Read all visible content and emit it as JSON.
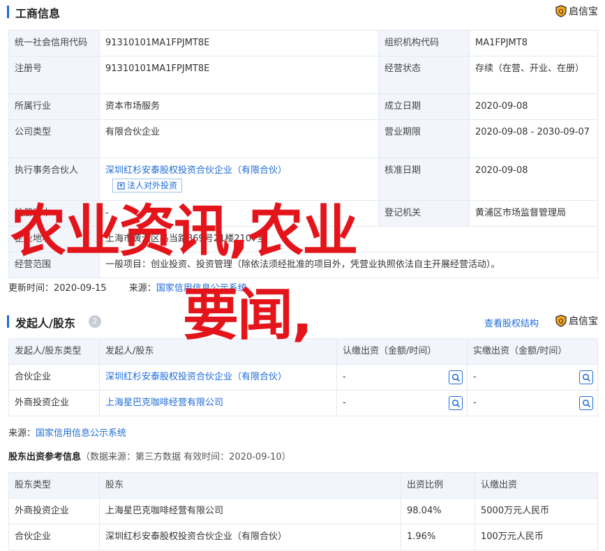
{
  "business_info": {
    "title": "工商信息",
    "brand": "启信宝",
    "rows": [
      {
        "l1": "统一社会信用代码",
        "v1": "91310101MA1FPJMT8E",
        "l2": "组织机构代码",
        "v2": "MA1FPJMT8"
      },
      {
        "l1": "注册号",
        "v1": "91310101MA1FPJMT8E",
        "l2": "经营状态",
        "v2": "存续（在营、开业、在册）"
      },
      {
        "l1": "所属行业",
        "v1": "资本市场服务",
        "l2": "成立日期",
        "v2": "2020-09-08"
      },
      {
        "l1": "公司类型",
        "v1": "有限合伙企业",
        "l2": "营业期限",
        "v2": "2020-09-08 - 2030-09-07"
      },
      {
        "l1": "执行事务合伙人",
        "v1": "深圳红杉安泰股权投资合伙企业（有限合伙）",
        "tag": "法人对外投资",
        "l2": "核准日期",
        "v2": "2020-09-08"
      },
      {
        "l1": "注册资本",
        "v1": "-",
        "l2": "登记机关",
        "v2": "黄浦区市场监督管理局"
      },
      {
        "l1": "企业地址",
        "v1": "上海市黄浦区马当路369号21楼2107室",
        "l2": "",
        "v2": ""
      },
      {
        "l1": "经营范围",
        "v1": "一般项目：创业投资、投资管理（除依法须经批准的项目外，凭营业执照依法自主开展经营活动）。",
        "l2": "",
        "v2": ""
      }
    ],
    "update_label": "更新时间：",
    "update_time": "2020-09-15",
    "source_label": "来源：",
    "source": "国家信用信息公示系统"
  },
  "shareholders": {
    "title": "发起人/股东",
    "count": "2",
    "equity_link": "查看股权结构",
    "brand": "启信宝",
    "headers": [
      "发起人/股东类型",
      "发起人/股东",
      "认缴出资（金额/时间）",
      "实缴出资（金额/时间）"
    ],
    "rows": [
      {
        "type": "合伙企业",
        "name": "深圳红杉安泰股权投资合伙企业（有限合伙）",
        "subscribed": "-",
        "paid": "-"
      },
      {
        "type": "外商投资企业",
        "name": "上海星巴克咖啡经营有限公司",
        "subscribed": "-",
        "paid": "-"
      }
    ],
    "source_label": "来源：",
    "source": "国家信用信息公示系统"
  },
  "reference": {
    "title": "股东出资参考信息",
    "meta": "（数据来源：第三方数据 有效时间：2020-09-10）",
    "headers": [
      "股东类型",
      "股东",
      "出资比例",
      "认缴出资"
    ],
    "rows": [
      {
        "type": "外商投资企业",
        "name": "上海星巴克咖啡经营有限公司",
        "ratio": "98.04%",
        "amount": "5000万元人民币"
      },
      {
        "type": "合伙企业",
        "name": "深圳红杉安泰股权投资合伙企业（有限合伙）",
        "ratio": "1.96%",
        "amount": "100万元人民币"
      }
    ]
  },
  "overlay": {
    "line1": "农业资讯,农业",
    "line2": "要闻,"
  },
  "colors": {
    "accent": "#1e6bd8",
    "overlay": "#e4141b",
    "label_bg": "#f2f6fc"
  }
}
